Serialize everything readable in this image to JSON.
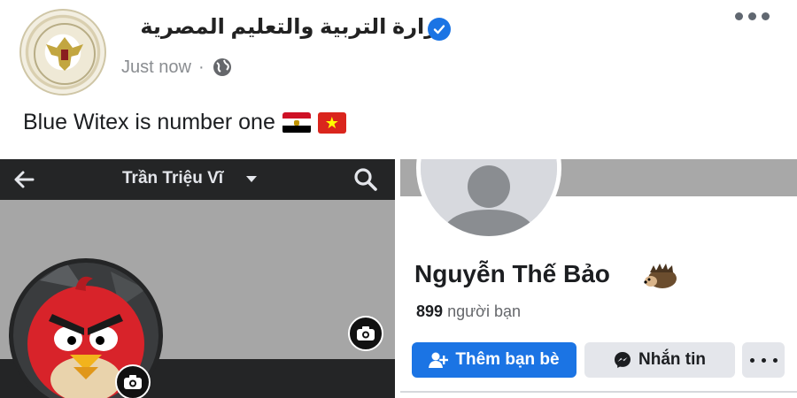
{
  "post": {
    "page_name": "وزارة التربية والتعليم المصرية",
    "verified_icon": "verified-badge-icon",
    "timestamp": "Just now",
    "separator": "·",
    "privacy_icon": "globe-icon",
    "text": "Blue Witex is number one",
    "flags": [
      "egypt-flag",
      "vietnam-flag"
    ],
    "menu_icon": "more-options-icon"
  },
  "left_screenshot": {
    "title": "Trần Triệu Vĩ",
    "back_icon": "back-arrow-icon",
    "search_icon": "search-icon",
    "avatar_icon": "angry-bird-avatar",
    "camera_icon": "camera-icon"
  },
  "right_screenshot": {
    "name": "Nguyễn Thế Bảo",
    "name_emoji_icon": "hedgehog-icon",
    "friends_count": "899",
    "friends_label": "người bạn",
    "buttons": {
      "add_friend": "Thêm bạn bè",
      "message": "Nhắn tin"
    }
  },
  "colors": {
    "facebook_blue": "#1b74e4",
    "dark_bar": "#242526",
    "secondary_button": "#e4e6eb",
    "meta_gray": "#8a8d91"
  }
}
